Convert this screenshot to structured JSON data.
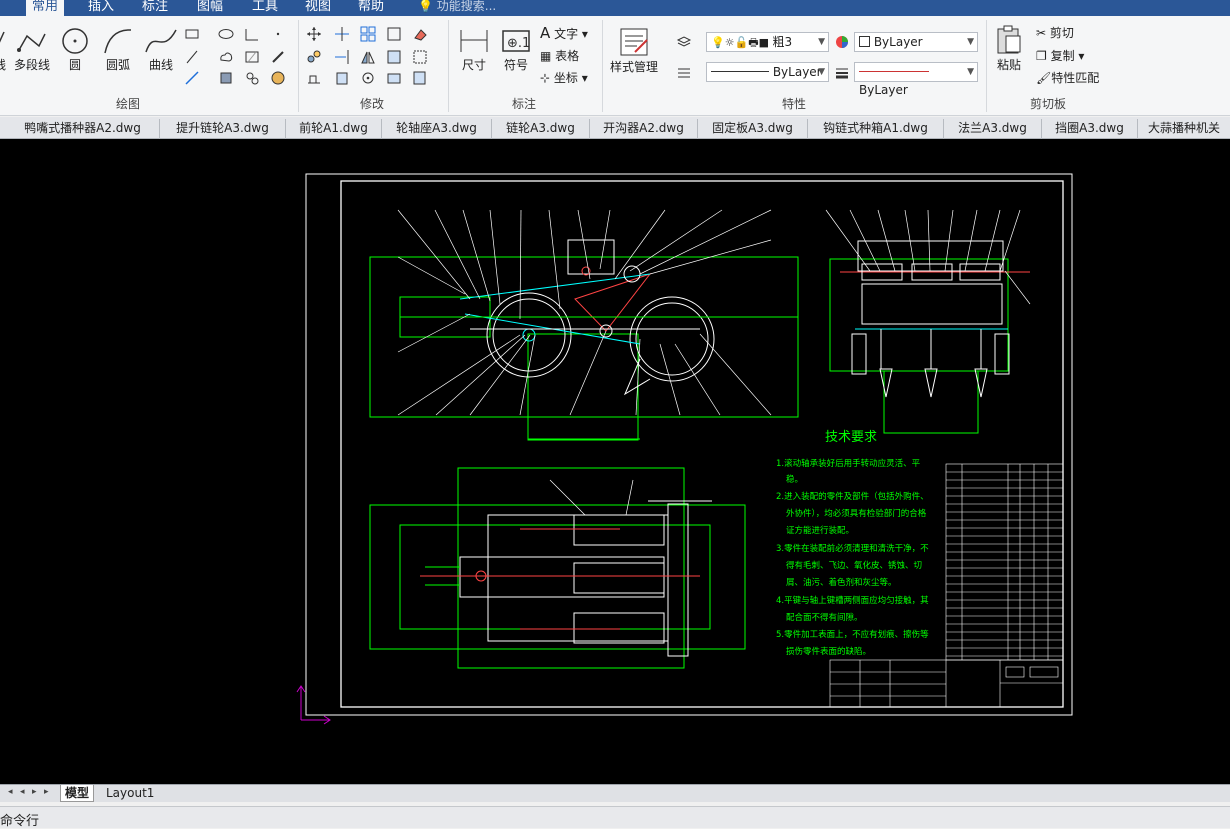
{
  "menu": {
    "tabs": [
      "常用",
      "插入",
      "标注",
      "图幅",
      "工具",
      "视图",
      "帮助"
    ],
    "search_placeholder": "功能搜索..."
  },
  "ribbon": {
    "draw": {
      "label": "绘图",
      "tools": [
        "线",
        "多段线",
        "圆",
        "圆弧",
        "曲线"
      ]
    },
    "modify": {
      "label": "修改"
    },
    "annotate": {
      "label": "标注",
      "tools": [
        "尺寸",
        "符号"
      ],
      "text": "文字",
      "table": "表格",
      "coord": "坐标"
    },
    "style": {
      "label": "样式管理"
    },
    "properties": {
      "label": "特性",
      "layer_value": "粗3",
      "color_value": "ByLayer",
      "linetype_value": "ByLayer",
      "lineweight_value": "ByLayer"
    },
    "clipboard": {
      "label": "剪切板",
      "paste": "粘贴",
      "cut": "剪切",
      "copy": "复制",
      "match": "特性匹配"
    }
  },
  "file_tabs": [
    "鸭嘴式播种器A2.dwg",
    "提升链轮A3.dwg",
    "前轮A1.dwg",
    "轮轴座A3.dwg",
    "链轮A3.dwg",
    "开沟器A2.dwg",
    "固定板A3.dwg",
    "钩链式种箱A1.dwg",
    "法兰A3.dwg",
    "挡圈A3.dwg",
    "大蒜播种机关"
  ],
  "drawing": {
    "tech_title": "技术要求",
    "tech_lines": [
      "1.滚动轴承装好后用手转动应灵活、平",
      "稳。",
      "2.进入装配的零件及部件（包括外购件、",
      "外协件），均必须具有检验部门的合格",
      "证方能进行装配。",
      "3.零件在装配前必须清理和清洗干净，不",
      "得有毛刺、飞边、氧化皮、锈蚀、切",
      "屑、油污、着色剂和灰尘等。",
      "4.平键与轴上键槽两侧面应均匀接触，其",
      "配合面不得有间隙。",
      "5.零件加工表面上，不应有划痕、擦伤等",
      "损伤零件表面的缺陷。"
    ]
  },
  "layout_tabs": [
    "模型",
    "Layout1"
  ],
  "command_line": "命令行",
  "colors": {
    "accent": "#2b5797",
    "canvas": "#000000",
    "cad_green": "#00ff00",
    "cad_white": "#ffffff",
    "cad_cyan": "#00ffff"
  }
}
